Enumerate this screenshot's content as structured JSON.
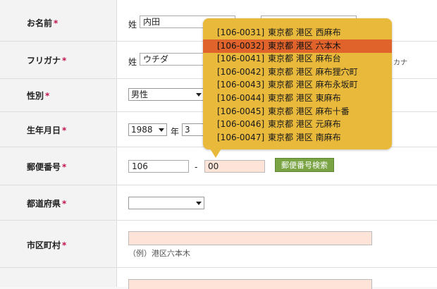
{
  "form": {
    "rows": {
      "name": {
        "label": "お名前",
        "req": "*",
        "sei_prefix": "姓",
        "sei_value": "内田",
        "mei_value": ""
      },
      "furigana": {
        "label": "フリガナ",
        "req": "*",
        "sei_prefix": "姓",
        "sei_value": "ウチダ",
        "suffix": "カナ"
      },
      "gender": {
        "label": "性別",
        "req": "*",
        "value": "男性"
      },
      "birthday": {
        "label": "生年月日",
        "req": "*",
        "year": "1988",
        "year_unit": "年",
        "month": "3"
      },
      "postal": {
        "label": "郵便番号",
        "req": "*",
        "first": "106",
        "dash": "-",
        "second": "00",
        "search_button": "郵便番号検索"
      },
      "prefecture": {
        "label": "都道府県",
        "req": "*",
        "value": ""
      },
      "city": {
        "label": "市区町村",
        "req": "*",
        "value": "",
        "hint": "（例）港区六本木"
      }
    }
  },
  "suggestions": [
    {
      "code": "[106-0031]",
      "address": "東京都 港区 西麻布"
    },
    {
      "code": "[106-0032]",
      "address": "東京都 港区 六本木",
      "active": true
    },
    {
      "code": "[106-0041]",
      "address": "東京都 港区 麻布台"
    },
    {
      "code": "[106-0042]",
      "address": "東京都 港区 麻布狸穴町"
    },
    {
      "code": "[106-0043]",
      "address": "東京都 港区 麻布永坂町"
    },
    {
      "code": "[106-0044]",
      "address": "東京都 港区 東麻布"
    },
    {
      "code": "[106-0045]",
      "address": "東京都 港区 麻布十番"
    },
    {
      "code": "[106-0046]",
      "address": "東京都 港区 元麻布"
    },
    {
      "code": "[106-0047]",
      "address": "東京都 港区 南麻布"
    }
  ],
  "colors": {
    "popup": "#e9b93b",
    "active": "#e0632b",
    "required": "#c0144c",
    "button": "#7aa443"
  }
}
